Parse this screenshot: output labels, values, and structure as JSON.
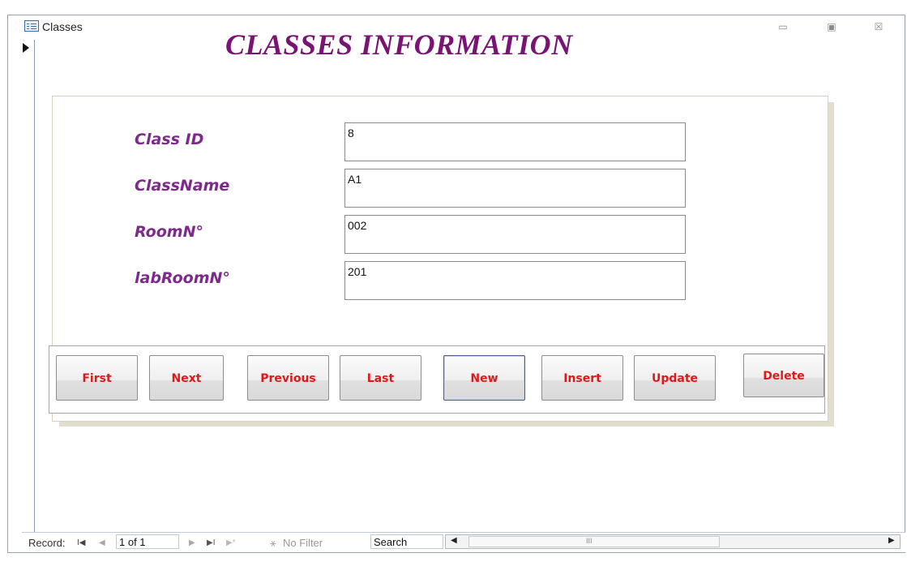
{
  "window": {
    "title": "Classes",
    "minimize_glyph": "▭",
    "restore_glyph": "▣",
    "close_glyph": "☒"
  },
  "form": {
    "heading": "CLASSES INFORMATION",
    "fields": [
      {
        "label": "Class ID",
        "value": "8"
      },
      {
        "label": "ClassName",
        "value": "A1"
      },
      {
        "label": "RoomN°",
        "value": "002"
      },
      {
        "label": "labRoomN°",
        "value": "201"
      }
    ]
  },
  "buttons": {
    "first": "First",
    "next": "Next",
    "previous": "Previous",
    "last": "Last",
    "new": "New",
    "insert": "Insert",
    "update": "Update",
    "delete": "Delete"
  },
  "record_nav": {
    "label": "Record:",
    "first_glyph": "I◀",
    "prev_glyph": "◀",
    "current": "1 of 1",
    "next_glyph": "▶",
    "last_glyph": "▶I",
    "new_glyph": "▶*",
    "filter_text": "No Filter",
    "search_text": "Search",
    "scroll_left_glyph": "◀",
    "scroll_right_glyph": "▶",
    "scroll_thumb_glyph": "III"
  },
  "colors": {
    "heading": "#7a1474",
    "field_label": "#7d2a8c",
    "button_text": "#e2171a"
  }
}
